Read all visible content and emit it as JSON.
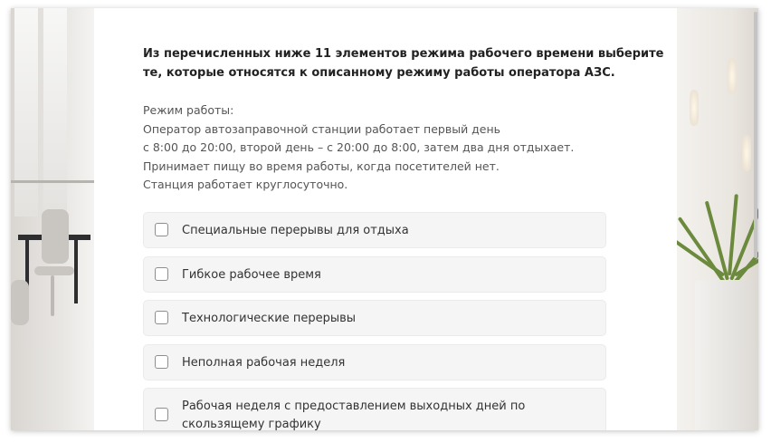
{
  "question": "Из перечисленных ниже 11 элементов режима рабочего времени выберите те, которые относятся к описанному режиму работы оператора АЗС.",
  "description": {
    "lines": [
      "Режим работы:",
      "Оператор автозаправочной станции работает первый день",
      "с 8:00 до 20:00, второй день – с 20:00 до 8:00, затем два дня отдыхает.",
      "Принимает пищу во время работы, когда посетителей нет.",
      "Станция работает круглосуточно."
    ]
  },
  "options": [
    {
      "label": "Специальные перерывы для отдыха",
      "checked": false
    },
    {
      "label": "Гибкое рабочее время",
      "checked": false
    },
    {
      "label": "Технологические перерывы",
      "checked": false
    },
    {
      "label": "Неполная рабочая неделя",
      "checked": false
    },
    {
      "label": "Рабочая неделя с предоставлением выходных дней по скользящему графику",
      "checked": false
    }
  ],
  "decor": {
    "left_image": "office-interior-image",
    "right_image": "potted-plant-image"
  },
  "colors": {
    "card_background": "#ffffff",
    "option_background": "#f5f5f5",
    "question_text": "#222222",
    "body_text": "#555555"
  }
}
